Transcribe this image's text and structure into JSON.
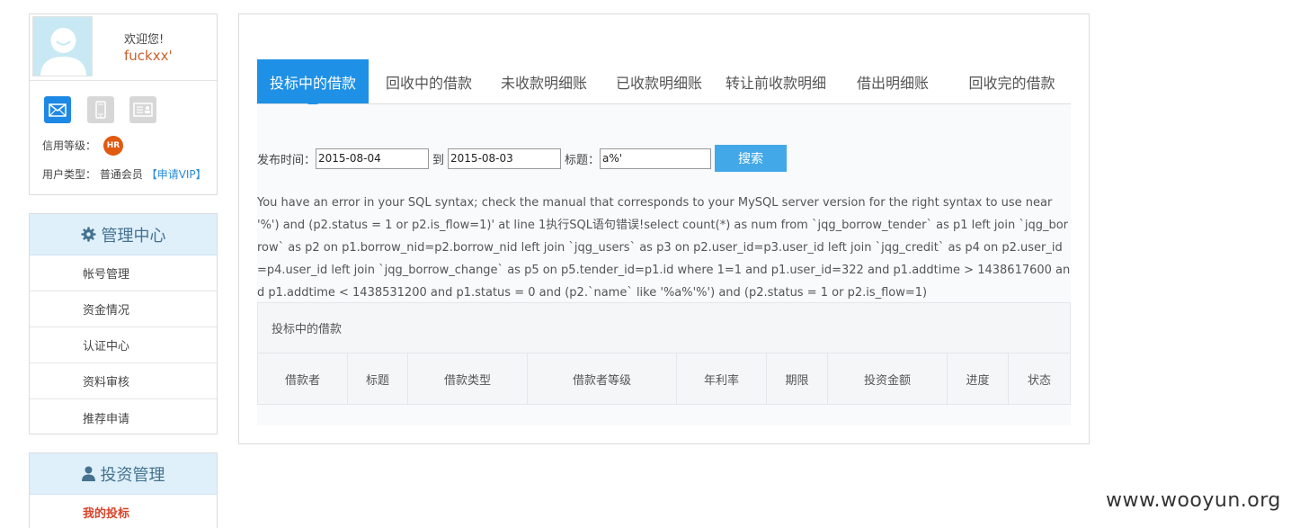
{
  "profile": {
    "welcome": "欢迎您!",
    "username": "fuckxx'",
    "credit_label": "信用等级：",
    "credit_badge": "HR",
    "usertype_label": "用户类型：",
    "usertype_value": "普通会员",
    "vip_link": "【申请VIP】",
    "verify_icons": [
      "email-icon",
      "phone-icon",
      "id-card-icon"
    ]
  },
  "management": {
    "title": "管理中心",
    "icon": "gear-icon",
    "items": [
      "帐号管理",
      "资金情况",
      "认证中心",
      "资料审核",
      "推荐申请"
    ]
  },
  "investment": {
    "title": "投资管理",
    "icon": "user-icon",
    "items": [
      "我的投标"
    ]
  },
  "tabs": [
    {
      "label": "投标中的借款",
      "active": true
    },
    {
      "label": "回收中的借款",
      "active": false
    },
    {
      "label": "未收款明细账",
      "active": false
    },
    {
      "label": "已收款明细账",
      "active": false
    },
    {
      "label": "转让前收款明细",
      "active": false
    },
    {
      "label": "借出明细账",
      "active": false
    },
    {
      "label": "回收完的借款",
      "active": false
    }
  ],
  "filter": {
    "date_label": "发布时间：",
    "date_from": "2015-08-04",
    "to_label": "到",
    "date_to": "2015-08-03",
    "title_label": "标题：",
    "title_value": "a%'",
    "search_button": "搜索"
  },
  "sql_error": "You have an error in your SQL syntax; check the manual that corresponds to your MySQL server version for the right syntax to use near '%') and (p2.status = 1 or p2.is_flow=1)' at line 1执行SQL语句错误!select count(*) as num from `jqg_borrow_tender` as p1 left join `jqg_borrow` as p2 on p1.borrow_nid=p2.borrow_nid left join `jqg_users` as p3 on p2.user_id=p3.user_id left join `jqg_credit` as p4 on p2.user_id=p4.user_id left join `jqg_borrow_change` as p5 on p5.tender_id=p1.id where 1=1 and p1.user_id=322 and p1.addtime > 1438617600 and p1.addtime < 1438531200 and p1.status = 0 and (p2.`name` like '%a%'%') and (p2.status = 1 or p2.is_flow=1)",
  "table": {
    "caption": "投标中的借款",
    "columns": [
      "借款者",
      "标题",
      "借款类型",
      "借款者等级",
      "年利率",
      "期限",
      "投资金额",
      "进度",
      "状态"
    ]
  },
  "watermark": "www.wooyun.org",
  "colors": {
    "accent": "#1e90e6",
    "username": "#c8602c",
    "badge": "#e05a10",
    "menu_head_bg": "#dff0fb",
    "active_menu_item": "#d9442a"
  }
}
